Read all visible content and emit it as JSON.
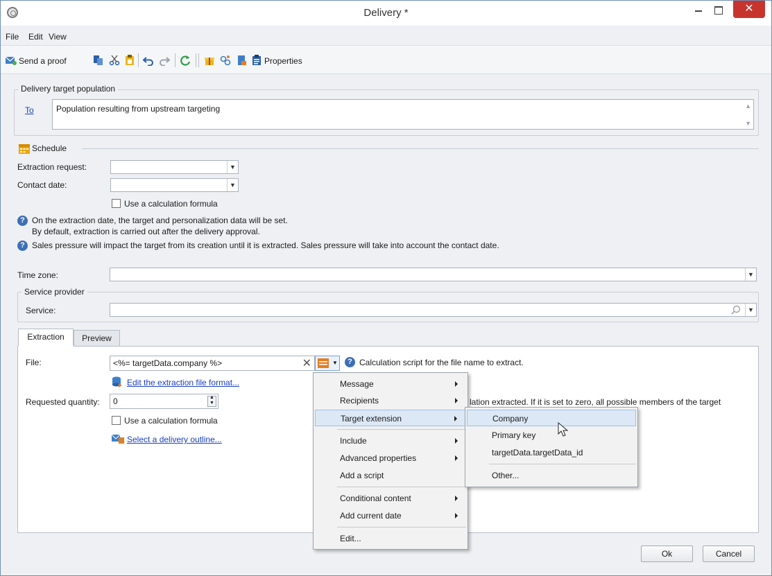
{
  "window": {
    "title": "Delivery *",
    "close_glyph": "✕"
  },
  "menubar": {
    "items": [
      "File",
      "Edit",
      "View"
    ]
  },
  "toolbar": {
    "send_proof_label": "Send a proof",
    "properties_label": "Properties"
  },
  "target": {
    "group_title": "Delivery target population",
    "to_link": "To",
    "population_text": "Population resulting from upstream targeting"
  },
  "schedule": {
    "title": "Schedule",
    "extraction_request_label": "Extraction request:",
    "contact_date_label": "Contact date:",
    "use_formula_label": "Use a calculation formula",
    "help_line_1a": "On the extraction date, the target and personalization data will be set.",
    "help_line_1b": "By default, extraction is carried out after the delivery approval.",
    "help_line_2": "Sales pressure will impact the target from its creation until it is extracted. Sales pressure will take into account the contact date."
  },
  "timezone": {
    "label": "Time zone:"
  },
  "service_provider": {
    "group_title": "Service provider",
    "service_label": "Service:"
  },
  "tabs": [
    {
      "label": "Extraction",
      "active": true
    },
    {
      "label": "Preview",
      "active": false
    }
  ],
  "extraction": {
    "file_label": "File:",
    "file_value": "<%= targetData.company %>",
    "file_help": "Calculation script for the file name to extract.",
    "edit_format_link": "Edit the extraction file format...",
    "requested_quantity_label": "Requested quantity:",
    "requested_quantity_value": "0",
    "quantity_help_partial": "lation extracted. If it is set to zero, all possible members of the target",
    "use_formula_label": "Use a calculation formula",
    "select_outline_link": "Select a delivery outline..."
  },
  "context_menu": {
    "items": [
      {
        "label": "Message",
        "submenu": true
      },
      {
        "label": "Recipients",
        "submenu": true
      },
      {
        "label": "Target extension",
        "submenu": true,
        "highlighted": true
      },
      {
        "label": "Include",
        "submenu": true
      },
      {
        "label": "Advanced properties",
        "submenu": true
      },
      {
        "label": "Add a script",
        "submenu": false
      },
      {
        "label": "Conditional content",
        "submenu": true
      },
      {
        "label": "Add current date",
        "submenu": true
      },
      {
        "label": "Edit...",
        "submenu": false
      }
    ]
  },
  "submenu": {
    "items": [
      {
        "label": "Company",
        "highlighted": true
      },
      {
        "label": "Primary key"
      },
      {
        "label": "targetData.targetData_id"
      },
      {
        "label": "Other..."
      }
    ]
  },
  "footer": {
    "ok_label": "Ok",
    "cancel_label": "Cancel"
  },
  "colors": {
    "accent": "#1a3fc1",
    "close_button": "#c7342e",
    "highlight": "#dce8f6"
  }
}
